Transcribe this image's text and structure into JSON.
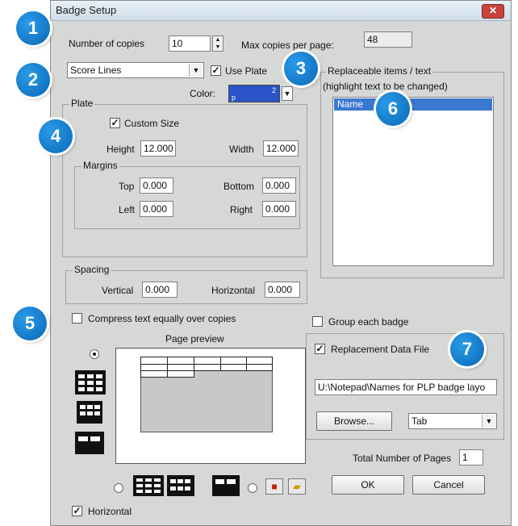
{
  "window": {
    "title": "Badge Setup",
    "close_label": "✕"
  },
  "callouts": [
    "1",
    "2",
    "3",
    "4",
    "5",
    "6",
    "7"
  ],
  "copies": {
    "label": "Number of copies",
    "value": "10",
    "max_label": "Max copies per page:",
    "max_value": "48"
  },
  "layout_select": {
    "value": "Score Lines"
  },
  "use_plate": {
    "label": "Use Plate",
    "checked": true
  },
  "color": {
    "label": "Color:",
    "value": "p",
    "swatch": "#2a54c8"
  },
  "replaceable": {
    "group_label": "Replaceable items / text",
    "hint": "(highlight text to be changed)",
    "items": [
      "Name"
    ]
  },
  "plate": {
    "group_label": "Plate",
    "custom_size_label": "Custom Size",
    "height_label": "Height",
    "height_value": "12.000",
    "width_label": "Width",
    "width_value": "12.000",
    "margins": {
      "group_label": "Margins",
      "top_label": "Top",
      "top_value": "0.000",
      "bottom_label": "Bottom",
      "bottom_value": "0.000",
      "left_label": "Left",
      "left_value": "0.000",
      "right_label": "Right",
      "right_value": "0.000"
    }
  },
  "spacing": {
    "group_label": "Spacing",
    "vertical_label": "Vertical",
    "vertical_value": "0.000",
    "horizontal_label": "Horizontal",
    "horizontal_value": "0.000"
  },
  "compress": {
    "label": "Compress text equally over copies",
    "checked": false
  },
  "group_each": {
    "label": "Group each badge",
    "checked": false
  },
  "preview": {
    "label": "Page preview"
  },
  "replacement": {
    "label": "Replacement Data File",
    "checked": true,
    "path": "U:\\Notepad\\Names for PLP badge layo",
    "browse_label": "Browse...",
    "delimiter": "Tab"
  },
  "total_pages": {
    "label": "Total Number of Pages",
    "value": "1"
  },
  "buttons": {
    "ok": "OK",
    "cancel": "Cancel"
  },
  "horizontal": {
    "label": "Horizontal",
    "checked": true
  },
  "colors": {
    "callout": "#1b86d6",
    "titlebar": "#dce7f1",
    "selection": "#3a78d0",
    "dialog_bg": "#d6d8d6"
  }
}
